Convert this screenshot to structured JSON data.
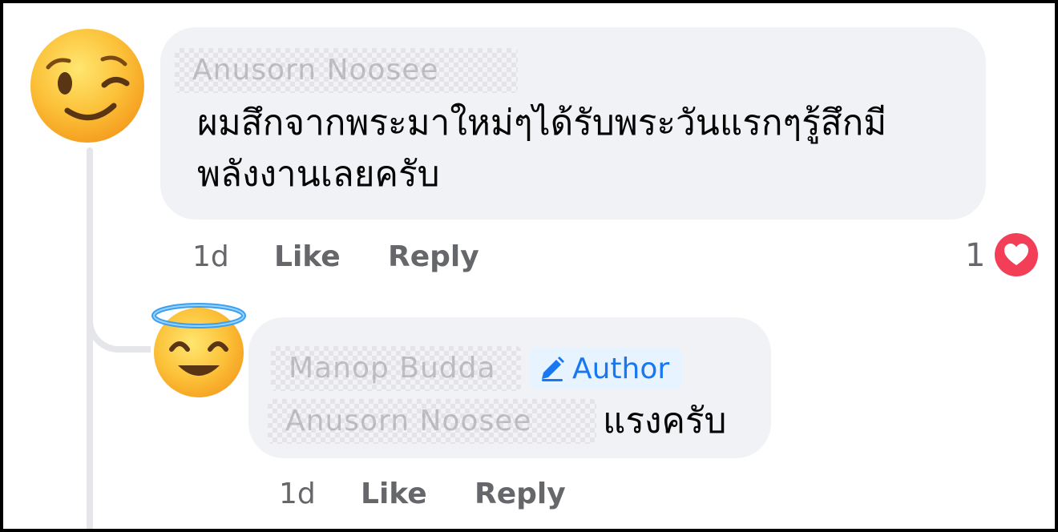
{
  "comment": {
    "author": "Anusorn Noosee",
    "text": "ผมสึกจากพระมาใหม่ๆได้รับพระวันแรกๆรู้สึกมีพลังงานเลยครับ",
    "time": "1d",
    "like_label": "Like",
    "reply_label": "Reply",
    "reaction_count": "1",
    "reaction_icon": "heart-icon",
    "avatar_icon": "winking-face-emoji"
  },
  "reply": {
    "author": "Manop Budda",
    "author_badge": "Author",
    "author_badge_icon": "pencil-icon",
    "mention": "Anusorn Noosee",
    "text": "แรงครับ",
    "time": "1d",
    "like_label": "Like",
    "reply_label": "Reply",
    "avatar_icon": "smiling-face-with-halo-emoji"
  },
  "colors": {
    "bubble": "#f0f2f5",
    "meta_text": "#65676b",
    "author_badge_text": "#1877f2",
    "author_badge_bg": "#e7f3ff",
    "heart": "#f33e58"
  }
}
